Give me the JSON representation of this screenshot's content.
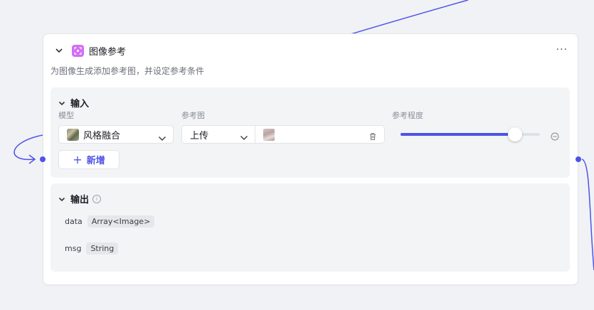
{
  "node": {
    "title": "图像参考",
    "description": "为图像生成添加参考图，并设定参考条件",
    "more_label": "···",
    "icon": "image-reference-icon",
    "icon_color": "#d26df5"
  },
  "input_section": {
    "title": "输入",
    "columns": {
      "model": "模型",
      "reference_image": "参考图",
      "reference_strength": "参考程度"
    },
    "row": {
      "model_value": "风格融合",
      "source_value": "上传",
      "strength": 0.82
    },
    "add_label": "新增",
    "add_icon": "plus-icon"
  },
  "output_section": {
    "title": "输出",
    "info_icon": "info-icon",
    "info_glyph": "i",
    "fields": [
      {
        "name": "data",
        "type": "Array<Image>"
      },
      {
        "name": "msg",
        "type": "String"
      }
    ]
  },
  "colors": {
    "accent": "#4d53e8",
    "canvas_bg": "#f1f2f5",
    "panel_bg": "#f3f4f6"
  }
}
